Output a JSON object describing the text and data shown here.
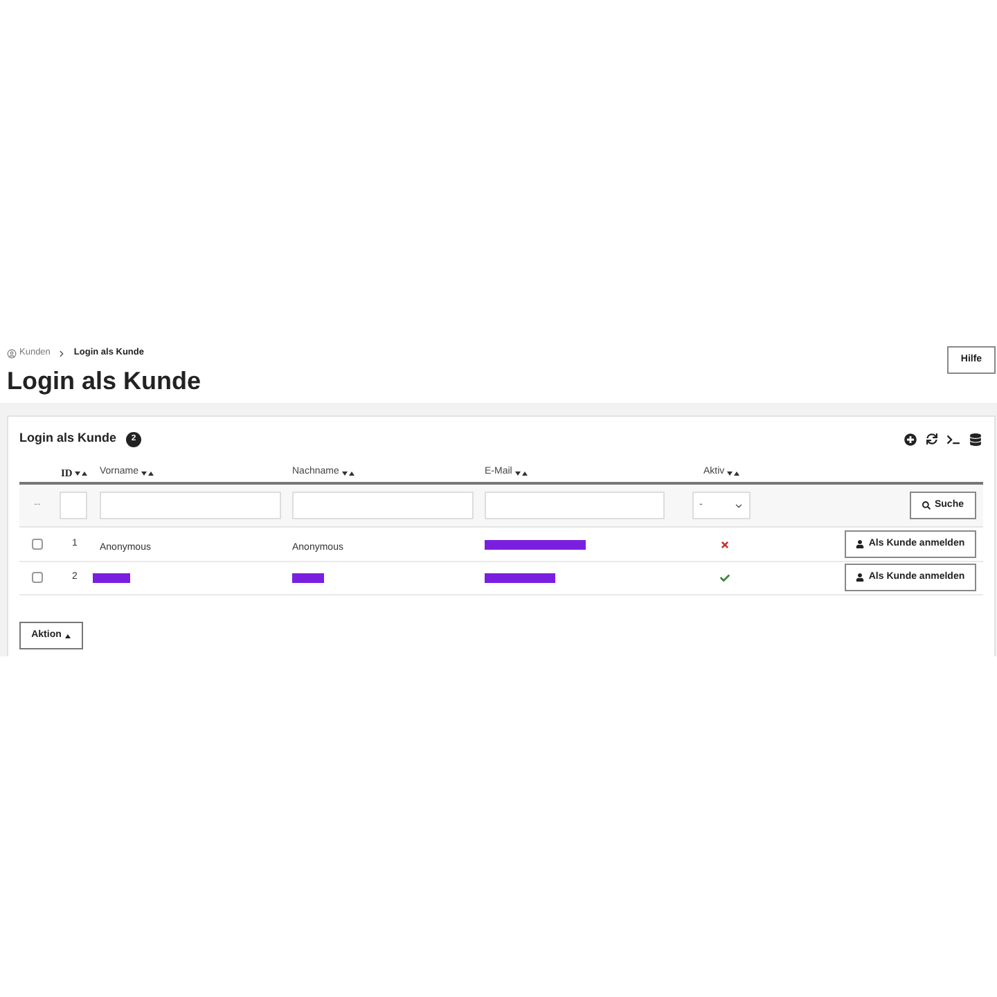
{
  "breadcrumb": [
    {
      "label": "Kunden",
      "current": false
    },
    {
      "label": "Login als Kunde",
      "current": true
    }
  ],
  "page_title": "Login als Kunde",
  "help_button": "Hilfe",
  "card": {
    "title": "Login als Kunde",
    "count": "2"
  },
  "table": {
    "columns": [
      {
        "label": "ID"
      },
      {
        "label": "Vorname"
      },
      {
        "label": "Nachname"
      },
      {
        "label": "E-Mail"
      },
      {
        "label": "Aktiv"
      }
    ],
    "filter": {
      "select_all": "--",
      "status_select": "-",
      "search_button": "Suche"
    },
    "rows": [
      {
        "checked": false,
        "id": "1",
        "first_name": {
          "kind": "text",
          "text": "Anonymous"
        },
        "last_name": {
          "kind": "text",
          "text": "Anonymous"
        },
        "email": {
          "kind": "redacted"
        },
        "active": false,
        "action": "Als Kunde anmelden"
      },
      {
        "checked": false,
        "id": "2",
        "first_name": {
          "kind": "redacted"
        },
        "last_name": {
          "kind": "redacted"
        },
        "email": {
          "kind": "redacted"
        },
        "active": true,
        "action": "Als Kunde anmelden"
      }
    ]
  },
  "action_button": "Aktion"
}
